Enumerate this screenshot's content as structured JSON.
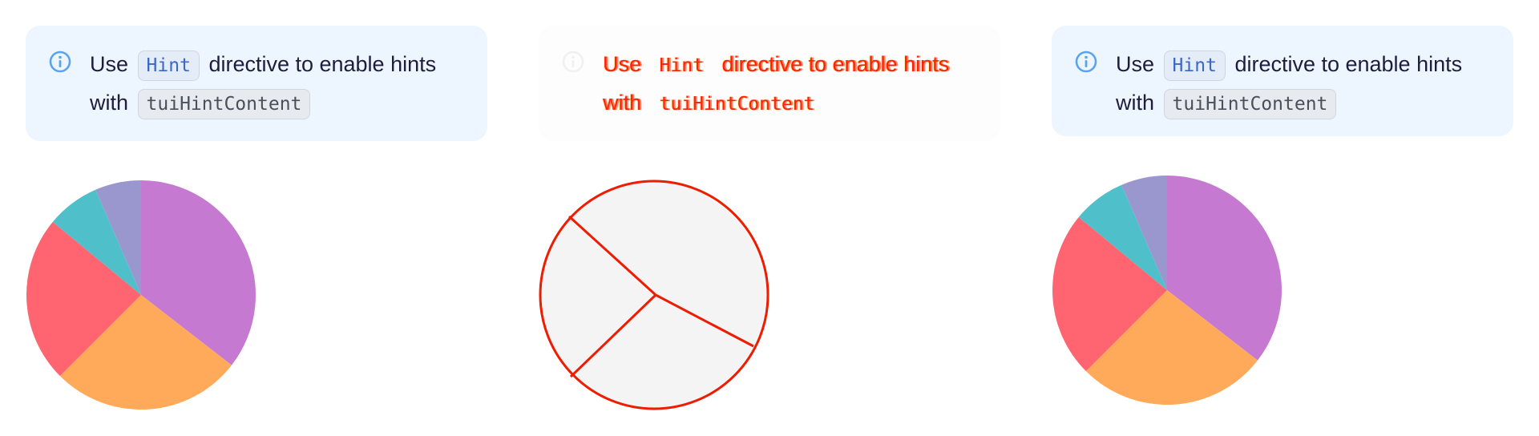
{
  "panels": [
    {
      "variant": "expected",
      "notice": {
        "icon": "info-circle-icon",
        "line1_before": "Use",
        "code_hint": "Hint",
        "line1_after": "directive to enable hints",
        "line2_before": "with",
        "code_content": "tuiHintContent"
      }
    },
    {
      "variant": "diff",
      "notice": {
        "icon": "info-circle-icon",
        "line1_before": "Use",
        "code_hint": "Hint",
        "line1_after": "directive to enable hints",
        "line2_before": "with",
        "code_content": "tuiHintContent"
      }
    },
    {
      "variant": "actual",
      "notice": {
        "icon": "info-circle-icon",
        "line1_before": "Use",
        "code_hint": "Hint",
        "line1_after": "directive to enable hints",
        "line2_before": "with",
        "code_content": "tuiHintContent"
      }
    }
  ],
  "chart_data": {
    "type": "pie",
    "values": [
      0.355,
      0.27,
      0.235,
      0.075,
      0.065
    ],
    "colors": [
      "#c679d1",
      "#ffa95b",
      "#ff6471",
      "#4fc0ca",
      "#9997cd"
    ],
    "diff_colors": {
      "fill": "#f4f4f4",
      "stroke": "#ee1c00"
    }
  },
  "theme": {
    "notice_bg": "#edf5ff",
    "icon_color": "#5aa3f0",
    "diff_red": "#ff2200"
  }
}
